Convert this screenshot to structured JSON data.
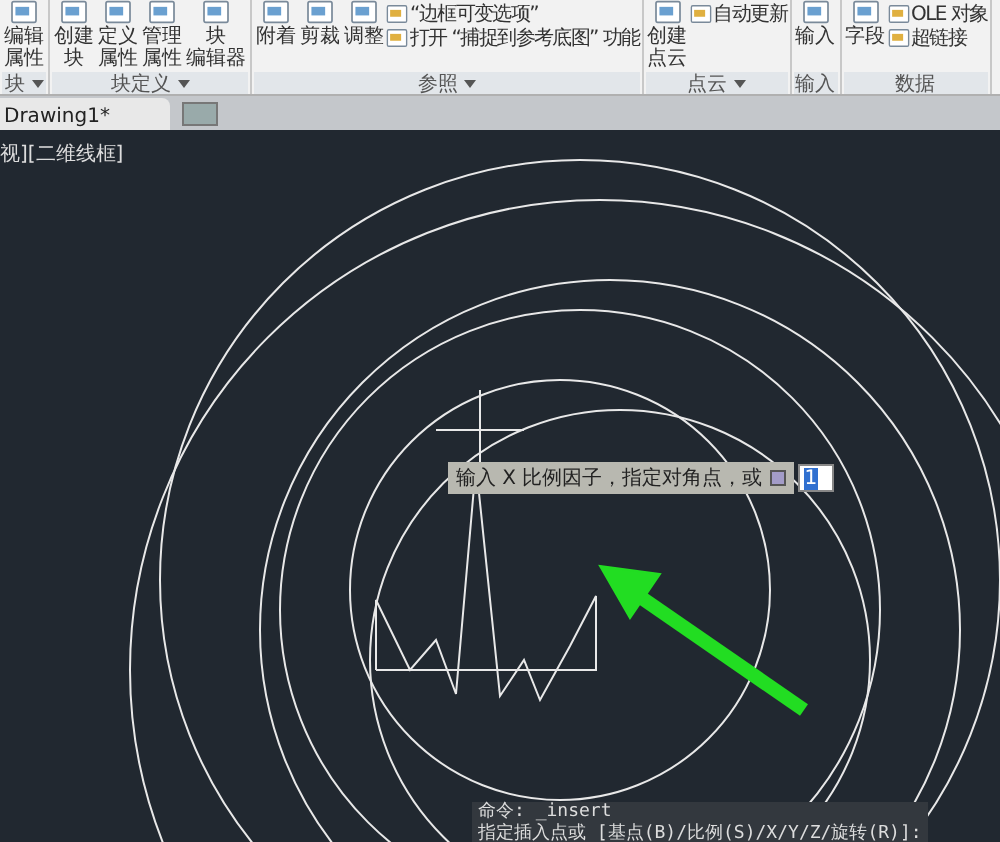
{
  "ribbon": {
    "panels": [
      {
        "title": "块",
        "menu": true,
        "large": [
          {
            "lines": [
              "编辑",
              "属性"
            ]
          }
        ]
      },
      {
        "title": "块定义",
        "menu": true,
        "large": [
          {
            "lines": [
              "创建",
              "块"
            ]
          },
          {
            "lines": [
              "定义",
              "属性"
            ]
          },
          {
            "lines": [
              "管理",
              "属性"
            ]
          },
          {
            "lines": [
              "块",
              "编辑器"
            ]
          }
        ]
      },
      {
        "title": "参照",
        "menu": true,
        "large": [
          {
            "lines": [
              "附着"
            ]
          },
          {
            "lines": [
              "剪裁"
            ]
          },
          {
            "lines": [
              "调整"
            ]
          }
        ],
        "small": [
          {
            "label": "“边框可变选项”"
          },
          {
            "label": "打开 “捕捉到参考底图” 功能"
          }
        ]
      },
      {
        "title": "点云",
        "menu": true,
        "large": [
          {
            "lines": [
              "创建",
              "点云"
            ]
          }
        ],
        "small": [
          {
            "label": "自动更新"
          }
        ]
      },
      {
        "title": "输入",
        "menu": false,
        "large": [
          {
            "lines": [
              "输入"
            ]
          }
        ]
      },
      {
        "title": "数据",
        "menu": false,
        "large": [
          {
            "lines": [
              "字段"
            ]
          }
        ],
        "small": [
          {
            "label": "OLE 对象"
          },
          {
            "label": "超链接"
          }
        ]
      }
    ]
  },
  "tabs": [
    {
      "label": "Drawing1*",
      "selected": true
    }
  ],
  "viewport_label": "视][二维线框]",
  "tooltip": {
    "text": "输入 X 比例因子，指定对角点，或",
    "value": "1"
  },
  "command_lines": [
    "命令: _insert",
    "指定插入点或 [基点(B)/比例(S)/X/Y/Z/旋转(R)]:"
  ]
}
